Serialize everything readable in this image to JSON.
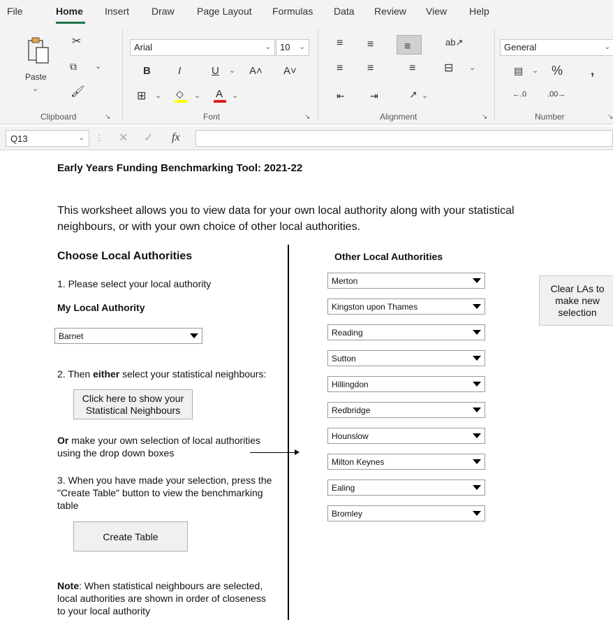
{
  "menu": {
    "tabs": [
      "File",
      "Home",
      "Insert",
      "Draw",
      "Page Layout",
      "Formulas",
      "Data",
      "Review",
      "View",
      "Help"
    ]
  },
  "ribbon": {
    "clipboard": {
      "paste_label": "Paste",
      "group_label": "Clipboard"
    },
    "font": {
      "font_name": "Arial",
      "font_size": "10",
      "group_label": "Font"
    },
    "alignment": {
      "group_label": "Alignment"
    },
    "number": {
      "format": "General",
      "group_label": "Number"
    }
  },
  "formula_bar": {
    "name_box": "Q13",
    "fx_symbol": "fx",
    "formula": ""
  },
  "sheet": {
    "title": "Early Years Funding Benchmarking Tool: 2021-22",
    "intro_line1": "This worksheet allows you to view data for your own local authority along with your statistical",
    "intro_line2": "neighbours, or with your own choice of other local authorities.",
    "choose_heading": "Choose Local Authorities",
    "step1": "1. Please select your local authority",
    "my_la_label": "My Local Authority",
    "my_la_value": "Barnet",
    "step2_prefix": "2. Then ",
    "step2_bold": "either",
    "step2_suffix": " select your statistical neighbours:",
    "show_neighbours_btn_line1": "Click here to show your",
    "show_neighbours_btn_line2": "Statistical Neighbours",
    "or_bold": "Or",
    "or_line1_rest": " make your own selection of local authorities",
    "or_line2": "using the drop down boxes",
    "step3_line1": "3. When you have made your selection, press the",
    "step3_line2": "\"Create Table\" button to view the benchmarking",
    "step3_line3": "table",
    "create_table_btn": "Create Table",
    "note_bold": "Note",
    "note_line1_rest": ": When statistical neighbours are selected,",
    "note_line2": "local authorities are shown in order of closeness",
    "note_line3": "to your local authority",
    "other_heading": "Other Local Authorities",
    "other_las": [
      "Merton",
      "Kingston upon Thames",
      "Reading",
      "Sutton",
      "Hillingdon",
      "Redbridge",
      "Hounslow",
      "Milton Keynes",
      "Ealing",
      "Bromley"
    ],
    "clear_btn_line1": "Clear LAs to",
    "clear_btn_line2": "make new",
    "clear_btn_line3": "selection"
  }
}
